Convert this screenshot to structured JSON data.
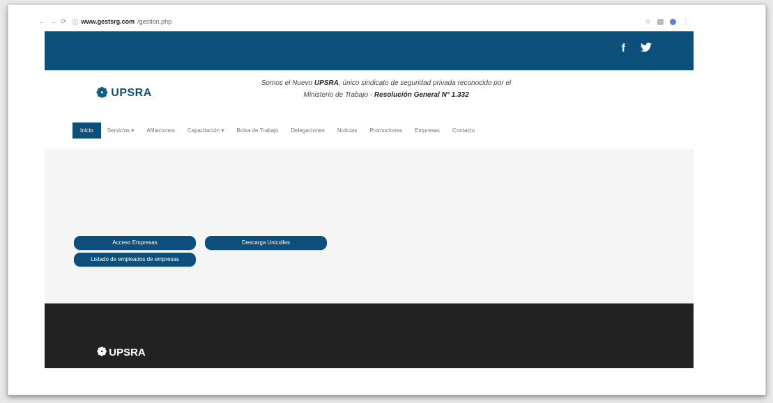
{
  "browser": {
    "url_host": "www.gestsrg.com",
    "url_path": "/gestion.php",
    "nav_back": "←",
    "nav_forward": "→",
    "reload": "⟳",
    "info": "ⓘ",
    "star": "☆",
    "menu": "⋮"
  },
  "topbar": {
    "social": [
      "f",
      "🐦"
    ]
  },
  "header": {
    "logo_text": "UPSRA",
    "tagline_prefix": "Somos el Nuevo",
    "tagline_brand": "UPSRA",
    "tagline_mid": ", único sindicato de seguridad privada reconocido por el",
    "tagline_line2_a": "Ministerio de Trabajo -",
    "tagline_line2_b": "Resolución General N° 1.332"
  },
  "navbar": {
    "items": [
      "Inicio",
      "Servicios ▾",
      "Afiliaciones",
      "Capacitación ▾",
      "Bolsa de Trabajo",
      "Delegaciones",
      "Noticias",
      "Promociones",
      "Empresas",
      "Contacto"
    ]
  },
  "content": {
    "btn_empresas": "Acceso Empresas",
    "btn_descarga": "Descarga Unicolles",
    "btn_listado": "Listado de empleados de empresas"
  },
  "footer": {
    "logo_text": "UPSRA"
  },
  "colors": {
    "brand": "#0b4f7a",
    "footer": "#222222"
  }
}
